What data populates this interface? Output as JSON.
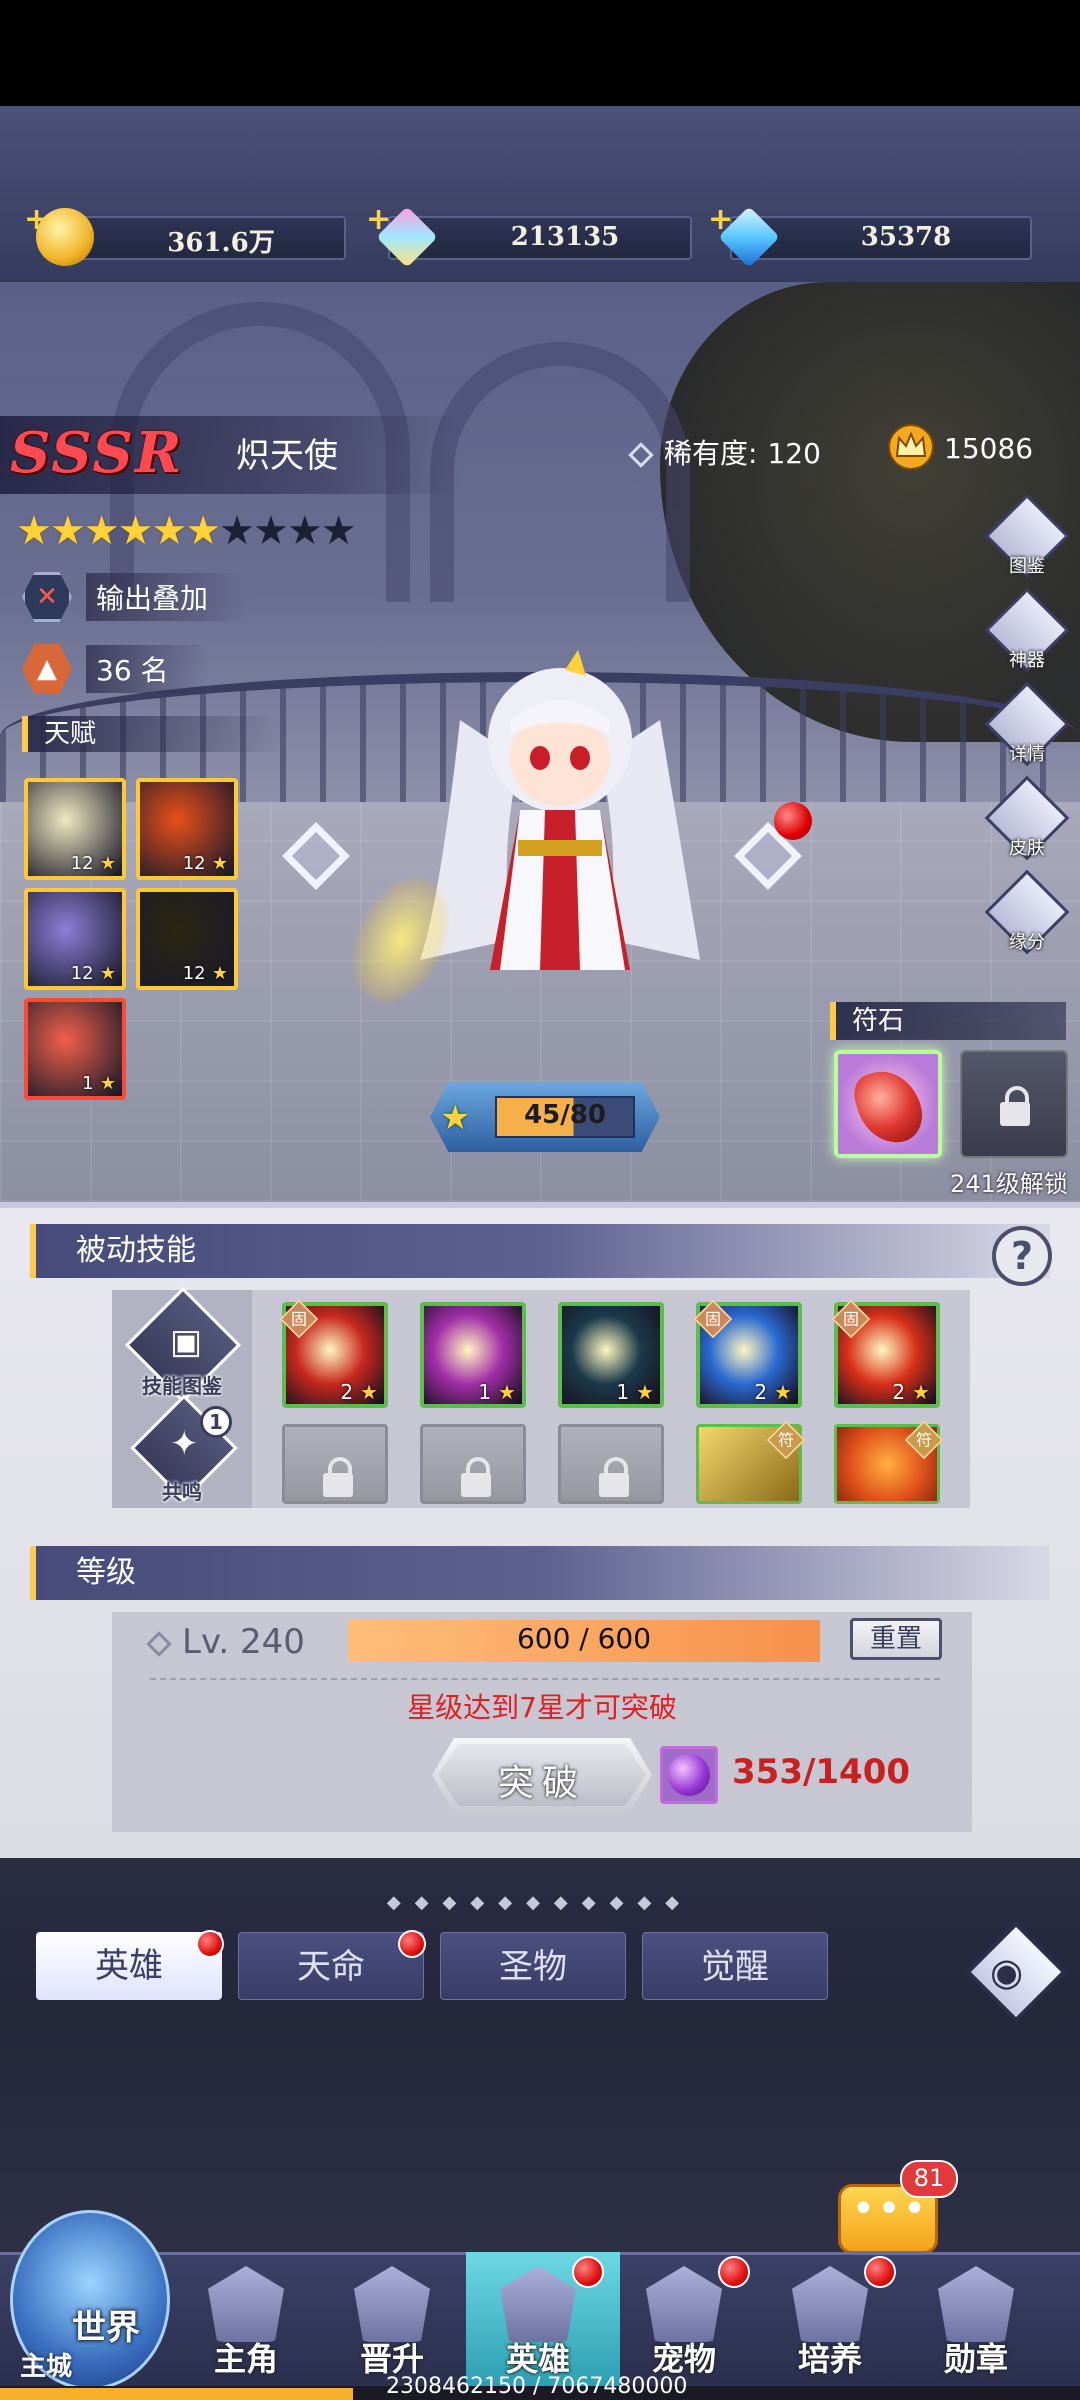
{
  "currencies": [
    {
      "name": "gold-coin-icon",
      "value": "361.6万"
    },
    {
      "name": "rainbow-crystal-icon",
      "value": "213135"
    },
    {
      "name": "blue-diamond-icon",
      "value": "35378"
    }
  ],
  "hero": {
    "rarity_grade": "SSSR",
    "name": "炽天使",
    "rarity_label": "稀有度:",
    "rarity_value": "120",
    "power": "15086",
    "stars_filled": 6,
    "stars_total": 10,
    "trait": "输出叠加",
    "rank": "36 名",
    "talent_header": "天赋",
    "talents": [
      {
        "level": "12",
        "color": "#f0e8c0"
      },
      {
        "level": "12",
        "color": "#e8501a"
      },
      {
        "level": "12",
        "color": "#8d7ed8"
      },
      {
        "level": "12",
        "color": "#2a2612"
      },
      {
        "level": "1",
        "color": "#f0604a"
      }
    ],
    "exp_text": "45/80",
    "exp_fraction": 0.5625
  },
  "side_buttons": [
    "图鉴",
    "神器",
    "详情",
    "皮肤",
    "缘分"
  ],
  "rune": {
    "header": "符石",
    "unlock_text": "241级解锁"
  },
  "passive": {
    "header": "被动技能",
    "left_buttons": [
      "技能图鉴",
      "共鸣"
    ],
    "resonance_badge": "1",
    "fixed_tag": "固",
    "special_tag": "符",
    "skills": [
      {
        "level": "2",
        "fixed": true,
        "color": "#c8281e"
      },
      {
        "level": "1",
        "fixed": false,
        "color": "#a22fa8"
      },
      {
        "level": "1",
        "fixed": false,
        "color": "#1b3a4a"
      },
      {
        "level": "2",
        "fixed": true,
        "color": "#2a6ad0"
      },
      {
        "level": "2",
        "fixed": true,
        "color": "#d83018"
      }
    ]
  },
  "level": {
    "header": "等级",
    "level_label": "Lv. 240",
    "exp_text": "600 / 600",
    "reset_label": "重置",
    "warning": "星级达到7星才可突破",
    "break_label": "突破",
    "material_count": "353/1400"
  },
  "tabs": [
    {
      "label": "英雄",
      "active": true,
      "dot": true
    },
    {
      "label": "天命",
      "active": false,
      "dot": true
    },
    {
      "label": "圣物",
      "active": false,
      "dot": false
    },
    {
      "label": "觉醒",
      "active": false,
      "dot": false
    }
  ],
  "chat_badge": "81",
  "bottom_nav": {
    "world_label": "世界",
    "world_sub": "主城",
    "items": [
      {
        "label": "主角",
        "dot": false
      },
      {
        "label": "晋升",
        "dot": false
      },
      {
        "label": "英雄",
        "dot": true
      },
      {
        "label": "宠物",
        "dot": true
      },
      {
        "label": "培养",
        "dot": true
      },
      {
        "label": "勋章",
        "dot": false
      }
    ]
  },
  "footer": {
    "progress_text": "2308462150 / 7067480000",
    "progress_fraction": 0.3266
  }
}
